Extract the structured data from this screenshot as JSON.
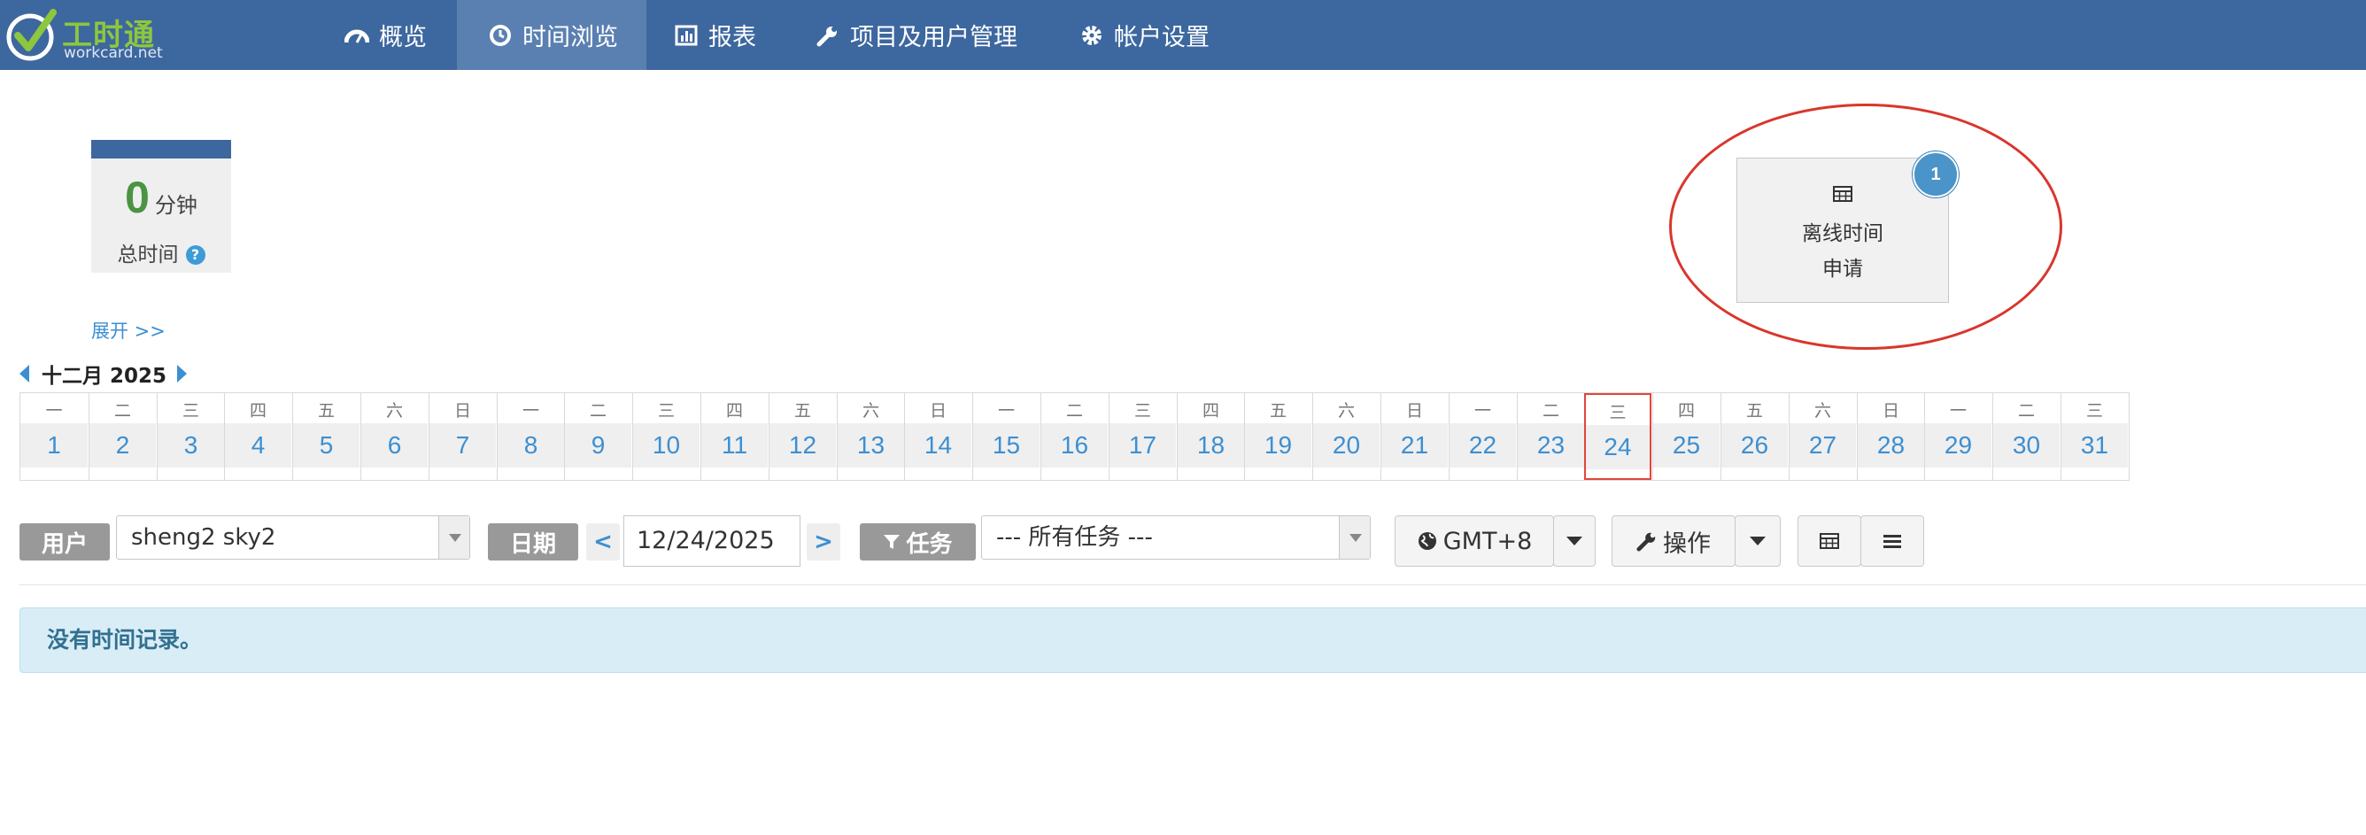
{
  "navbar": {
    "logo_title": "工时通",
    "logo_subtitle": "workcard.net",
    "items": [
      {
        "label": "概览",
        "icon": "dashboard-icon",
        "active": false
      },
      {
        "label": "时间浏览",
        "icon": "clock-icon",
        "active": true
      },
      {
        "label": "报表",
        "icon": "bar-chart-icon",
        "active": false
      },
      {
        "label": "项目及用户管理",
        "icon": "wrench-icon",
        "active": false
      },
      {
        "label": "帐户设置",
        "icon": "gear-icon",
        "active": false
      }
    ]
  },
  "summary": {
    "value": "0",
    "unit": "分钟",
    "label": "总时间",
    "help_icon": "?",
    "expand_label": "展开 >>"
  },
  "offline_request": {
    "line1": "离线时间",
    "line2": "申请",
    "badge": "1",
    "icon": "table-icon"
  },
  "calendar": {
    "month_label": "十二月 2025",
    "today": 24,
    "days": [
      {
        "n": "1",
        "w": "一"
      },
      {
        "n": "2",
        "w": "二"
      },
      {
        "n": "3",
        "w": "三"
      },
      {
        "n": "4",
        "w": "四"
      },
      {
        "n": "5",
        "w": "五"
      },
      {
        "n": "6",
        "w": "六"
      },
      {
        "n": "7",
        "w": "日"
      },
      {
        "n": "8",
        "w": "一"
      },
      {
        "n": "9",
        "w": "二"
      },
      {
        "n": "10",
        "w": "三"
      },
      {
        "n": "11",
        "w": "四"
      },
      {
        "n": "12",
        "w": "五"
      },
      {
        "n": "13",
        "w": "六"
      },
      {
        "n": "14",
        "w": "日"
      },
      {
        "n": "15",
        "w": "一"
      },
      {
        "n": "16",
        "w": "二"
      },
      {
        "n": "17",
        "w": "三"
      },
      {
        "n": "18",
        "w": "四"
      },
      {
        "n": "19",
        "w": "五"
      },
      {
        "n": "20",
        "w": "六"
      },
      {
        "n": "21",
        "w": "日"
      },
      {
        "n": "22",
        "w": "一"
      },
      {
        "n": "23",
        "w": "二"
      },
      {
        "n": "24",
        "w": "三"
      },
      {
        "n": "25",
        "w": "四"
      },
      {
        "n": "26",
        "w": "五"
      },
      {
        "n": "27",
        "w": "六"
      },
      {
        "n": "28",
        "w": "日"
      },
      {
        "n": "29",
        "w": "一"
      },
      {
        "n": "30",
        "w": "二"
      },
      {
        "n": "31",
        "w": "三"
      }
    ]
  },
  "filters": {
    "user_label": "用户",
    "user_value": "sheng2 sky2",
    "date_label": "日期",
    "date_prev": "<",
    "date_value": "12/24/2025",
    "date_next": ">",
    "task_label": "任务",
    "task_value": "--- 所有任务 ---",
    "timezone_label": "GMT+8",
    "actions_label": "操作"
  },
  "message": "没有时间记录。",
  "colors": {
    "navbar": "#3d679f",
    "navbar_active": "#5a80b2",
    "link": "#3d8fd1",
    "total_value": "#4a9442",
    "today_border": "#e0463b",
    "annotation": "#d9362c",
    "alert_bg": "#d9edf7"
  }
}
